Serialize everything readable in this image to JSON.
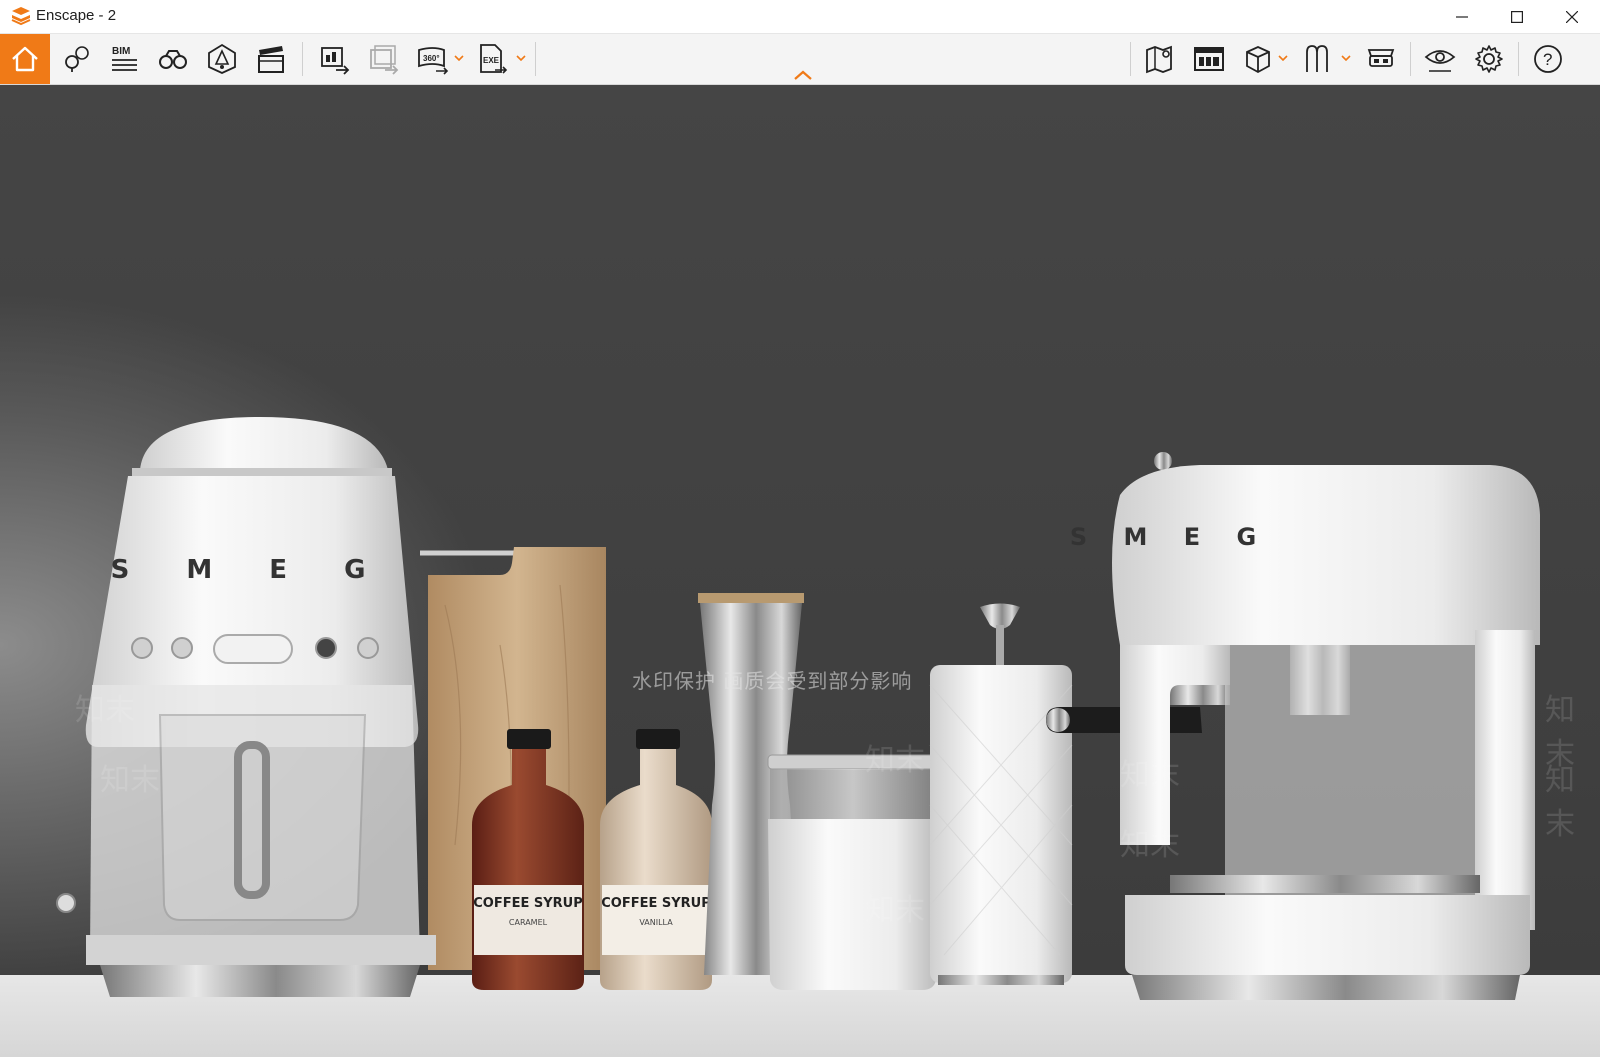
{
  "window": {
    "title": "Enscape - 2",
    "logo_icon": "enscape-logo-icon",
    "controls": [
      "minimize-icon",
      "maximize-icon",
      "close-icon"
    ]
  },
  "toolbar": {
    "accent_color": "#f07a17",
    "left_tools": [
      {
        "name": "home",
        "icon": "home-icon",
        "active": true
      },
      {
        "name": "views",
        "icon": "location-pin-icon"
      },
      {
        "name": "bim",
        "icon": "bim-info-icon",
        "label": "BIM"
      },
      {
        "name": "walk-mode",
        "icon": "binoculars-icon"
      },
      {
        "name": "sun",
        "icon": "atmosphere-icon"
      },
      {
        "name": "video",
        "icon": "clapperboard-icon"
      },
      {
        "name": "screenshot",
        "icon": "export-image-icon"
      },
      {
        "name": "batch",
        "icon": "batch-render-icon"
      },
      {
        "name": "panorama",
        "icon": "panorama-360-icon",
        "label": "360°",
        "has_dropdown": true
      },
      {
        "name": "export",
        "icon": "exe-export-icon",
        "label": "EXE",
        "has_dropdown": true
      }
    ],
    "right_tools": [
      {
        "name": "map",
        "icon": "map-icon"
      },
      {
        "name": "asset-library",
        "icon": "asset-library-icon"
      },
      {
        "name": "section",
        "icon": "box-icon",
        "has_dropdown": true
      },
      {
        "name": "materials",
        "icon": "material-editor-icon",
        "has_dropdown": true
      },
      {
        "name": "vr",
        "icon": "vr-headset-icon"
      },
      {
        "name": "visibility",
        "icon": "eye-icon"
      },
      {
        "name": "settings",
        "icon": "gear-icon"
      },
      {
        "name": "help",
        "icon": "help-icon",
        "label": "?"
      }
    ]
  },
  "viewport": {
    "wall_color": "#444444",
    "counter_color": "#dedede",
    "brand_text": "S M E G",
    "bottle_label_left": "COFFEE SYRUP",
    "bottle_sub_left": "CARAMEL",
    "bottle_label_right": "COFFEE SYRUP",
    "bottle_sub_right": "VANILLA",
    "watermark": "水印保护   画质会受到部分影响",
    "watermark_mark": "知末"
  }
}
